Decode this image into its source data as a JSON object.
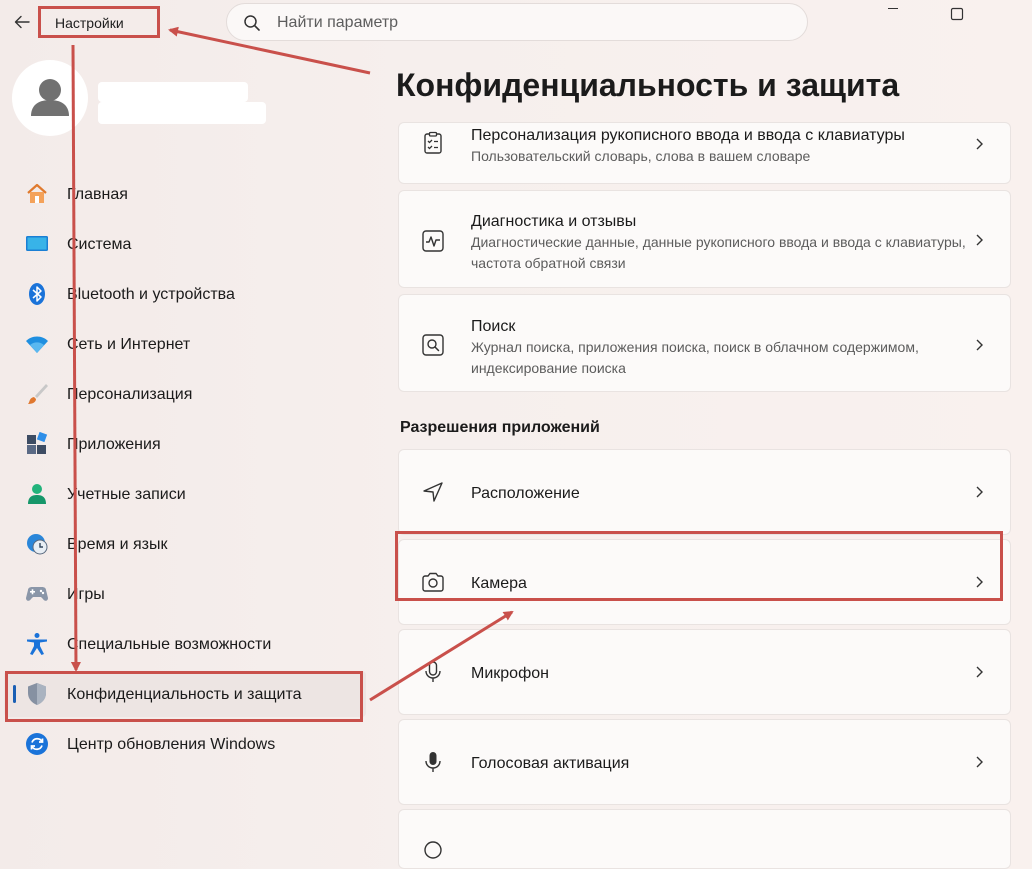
{
  "window": {
    "app_title": "Настройки",
    "back_icon": "arrow-left-icon",
    "minimize_icon": "minimize-icon",
    "maximize_icon": "maximize-icon"
  },
  "search": {
    "placeholder": "Найти параметр",
    "icon": "search-icon"
  },
  "sidebar": {
    "items": [
      {
        "label": "Главная",
        "icon": "home-icon"
      },
      {
        "label": "Система",
        "icon": "system-icon"
      },
      {
        "label": "Bluetooth и устройства",
        "icon": "bluetooth-icon"
      },
      {
        "label": "Сеть и Интернет",
        "icon": "wifi-icon"
      },
      {
        "label": "Персонализация",
        "icon": "brush-icon"
      },
      {
        "label": "Приложения",
        "icon": "apps-icon"
      },
      {
        "label": "Учетные записи",
        "icon": "account-icon"
      },
      {
        "label": "Время и язык",
        "icon": "clock-globe-icon"
      },
      {
        "label": "Игры",
        "icon": "gamepad-icon"
      },
      {
        "label": "Специальные возможности",
        "icon": "accessibility-icon"
      },
      {
        "label": "Конфиденциальность и защита",
        "icon": "shield-icon",
        "active": true
      },
      {
        "label": "Центр обновления Windows",
        "icon": "update-icon"
      }
    ]
  },
  "main": {
    "page_title": "Конфиденциальность и защита",
    "cards_top": [
      {
        "title": "Персонализация рукописного ввода и ввода с клавиатуры",
        "desc": "Пользовательский словарь, слова в вашем словаре",
        "icon": "clipboard-checklist-icon"
      },
      {
        "title": "Диагностика и отзывы",
        "desc": "Диагностические данные, данные рукописного ввода и ввода с клавиатуры, частота обратной связи",
        "icon": "diagnostics-icon"
      },
      {
        "title": "Поиск",
        "desc": "Журнал поиска, приложения поиска, поиск в облачном содержимом, индексирование поиска",
        "icon": "search-box-icon"
      }
    ],
    "section_title": "Разрешения приложений",
    "permissions": [
      {
        "title": "Расположение",
        "icon": "location-arrow-icon"
      },
      {
        "title": "Камера",
        "icon": "camera-icon"
      },
      {
        "title": "Микрофон",
        "icon": "microphone-icon"
      },
      {
        "title": "Голосовая активация",
        "icon": "microphone-filled-icon"
      }
    ]
  },
  "colors": {
    "annotation": "#c9504b",
    "accent": "#1a5fb4"
  }
}
